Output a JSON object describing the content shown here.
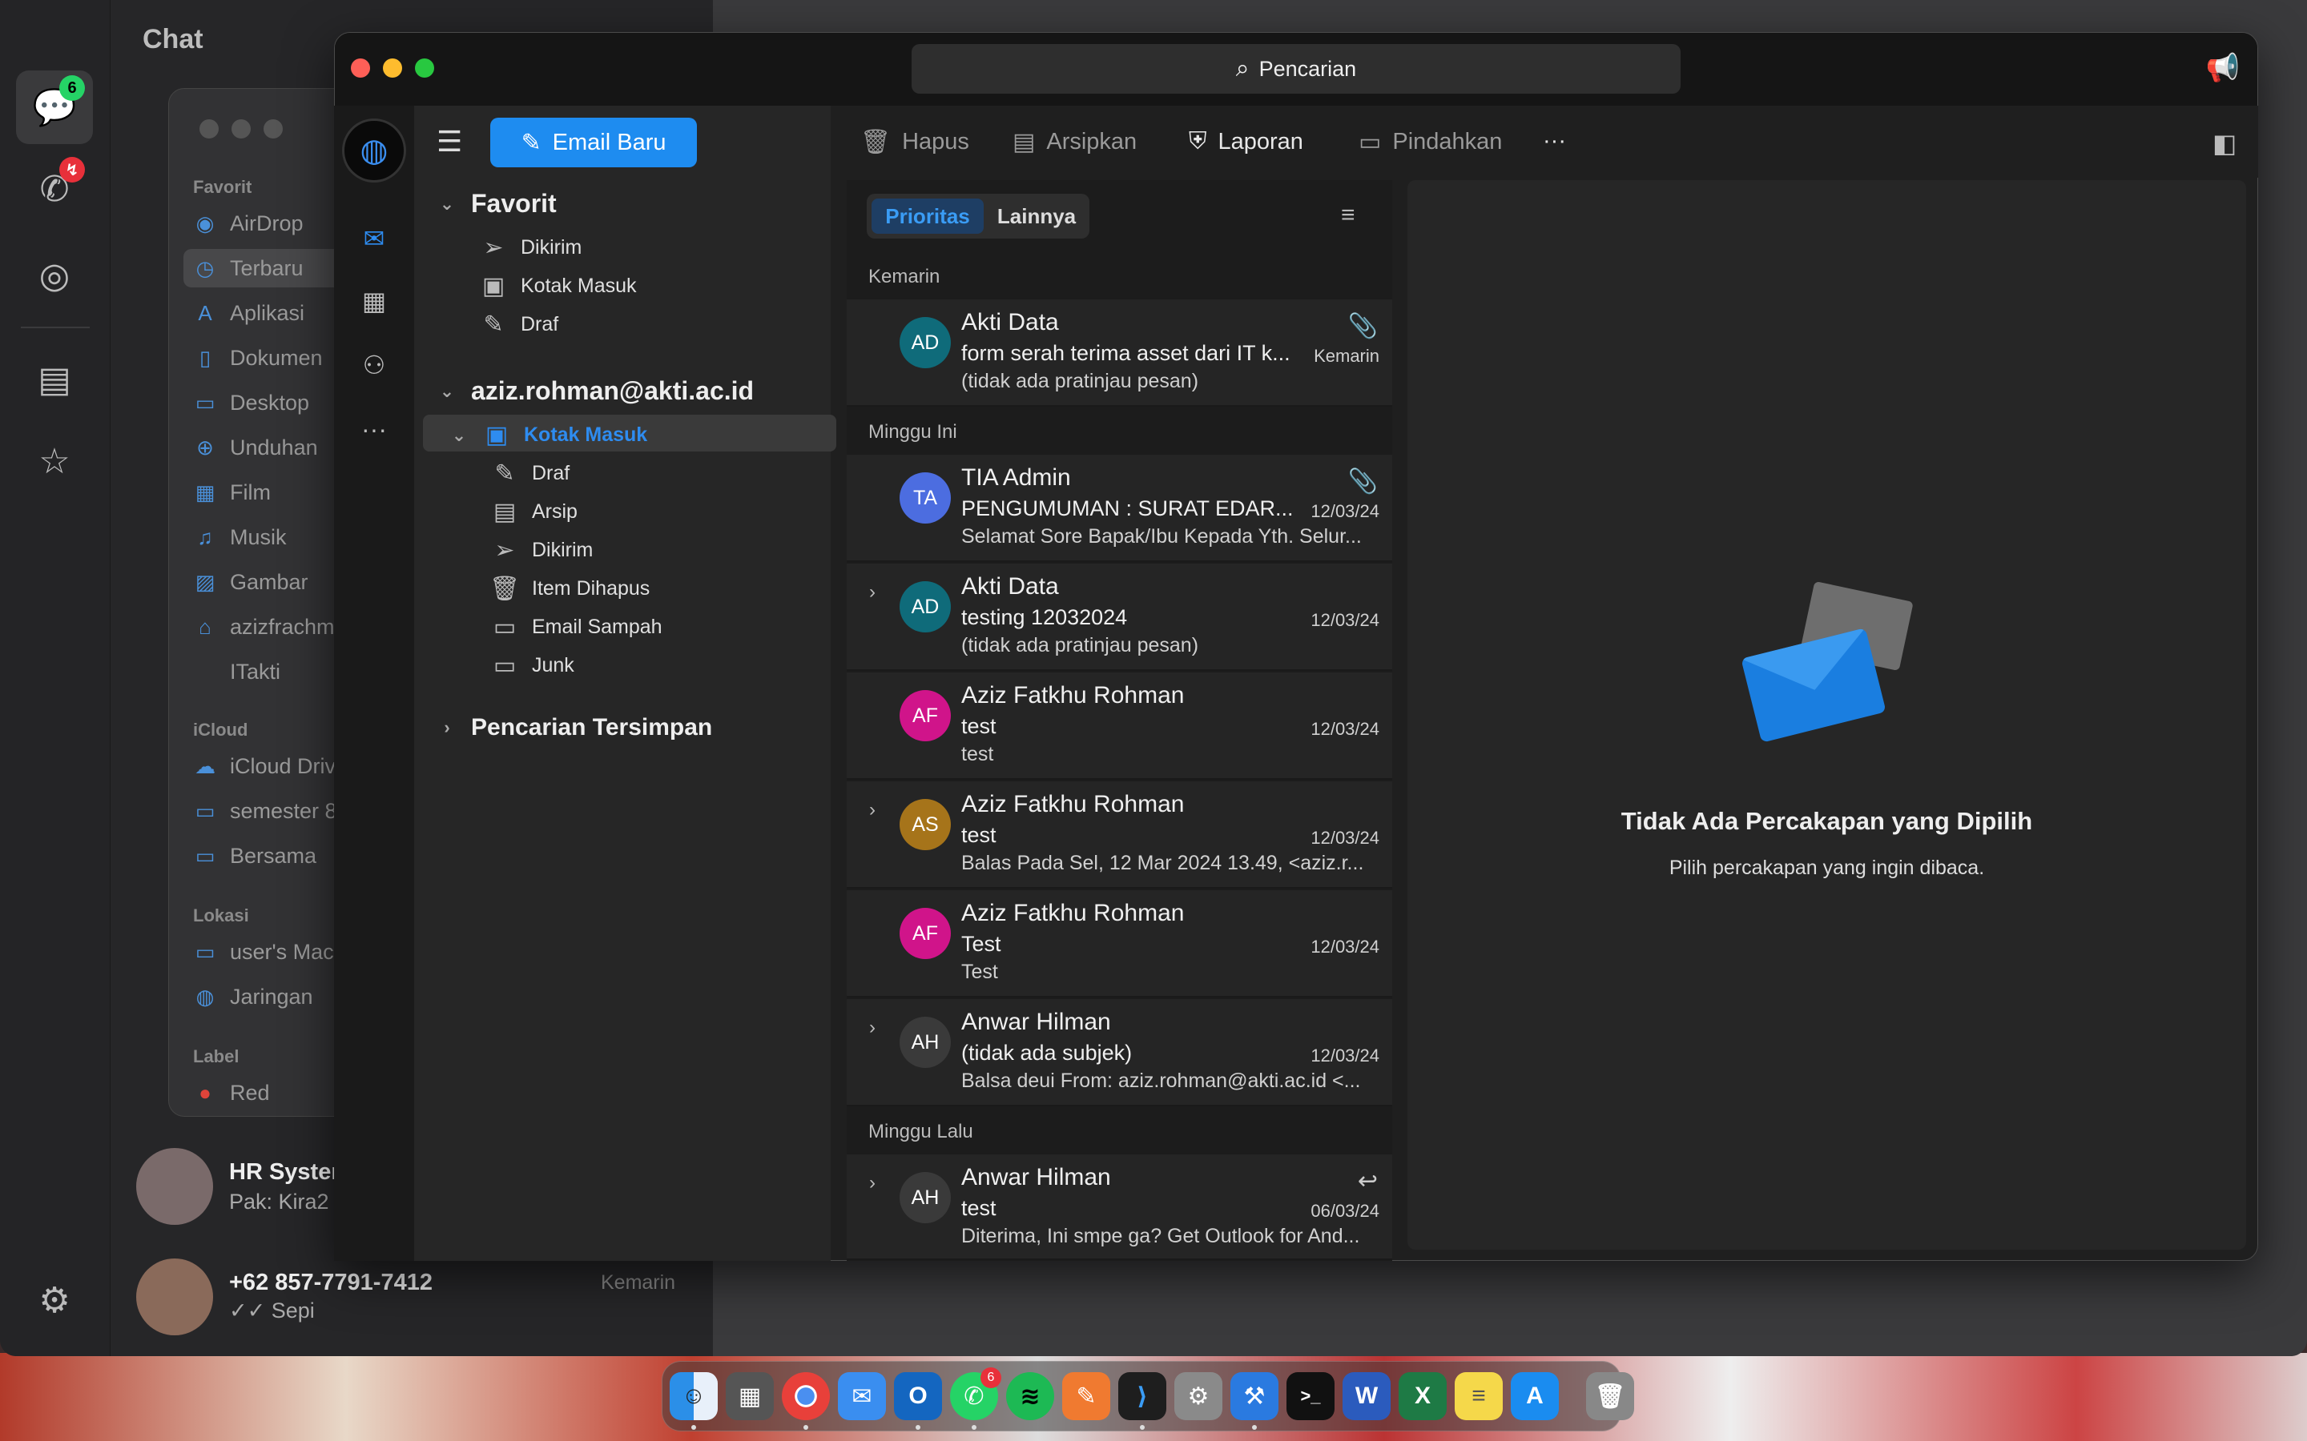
{
  "whatsapp": {
    "title": "Chat",
    "rail_badges": {
      "chats": "6"
    },
    "chats": [
      {
        "name": "HR Syster",
        "preview": "Pak: Kira2"
      },
      {
        "name": "+62 857-7791-7412",
        "preview": "✓✓ Sepi",
        "time": "Kemarin"
      }
    ]
  },
  "finder": {
    "sections": [
      {
        "title": "Favorit",
        "items": [
          "AirDrop",
          "Terbaru",
          "Aplikasi",
          "Dokumen",
          "Desktop",
          "Unduhan",
          "Film",
          "Musik",
          "Gambar",
          "azizfrachm",
          "ITakti"
        ]
      },
      {
        "title": "iCloud",
        "items": [
          "iCloud Driv",
          "semester 8",
          "Bersama"
        ]
      },
      {
        "title": "Lokasi",
        "items": [
          "user's Mac",
          "Jaringan"
        ]
      },
      {
        "title": "Label",
        "items": [
          "Red"
        ]
      }
    ]
  },
  "outlook": {
    "search_placeholder": "Pencarian",
    "new_mail": "Email Baru",
    "toolbar": {
      "delete": "Hapus",
      "archive": "Arsipkan",
      "report": "Laporan",
      "move": "Pindahkan",
      "more": "···"
    },
    "nav": {
      "favorites_title": "Favorit",
      "favorites": [
        "Dikirim",
        "Kotak Masuk",
        "Draf"
      ],
      "account": "aziz.rohman@akti.ac.id",
      "inbox": "Kotak Masuk",
      "folders": [
        "Draf",
        "Arsip",
        "Dikirim",
        "Item Dihapus",
        "Email Sampah",
        "Junk"
      ],
      "saved_searches": "Pencarian Tersimpan"
    },
    "tabs": {
      "focused": "Prioritas",
      "other": "Lainnya"
    },
    "headers": {
      "yesterday": "Kemarin",
      "this_week": "Minggu Ini",
      "last_week": "Minggu Lalu"
    },
    "messages": [
      {
        "initials": "AD",
        "color": "#0f6b7a",
        "sender": "Akti Data",
        "subject": "form serah terima asset dari IT k...",
        "preview": "(tidak ada pratinjau pesan)",
        "date": "Kemarin",
        "icon": "paperclip-icon"
      },
      {
        "initials": "TA",
        "color": "#4c6de0",
        "sender": "TIA Admin",
        "subject": "PENGUMUMAN : SURAT EDAR...",
        "preview": "Selamat Sore Bapak/Ibu Kepada Yth. Selur...",
        "date": "12/03/24",
        "icon": "paperclip-icon"
      },
      {
        "initials": "AD",
        "color": "#0f6b7a",
        "sender": "Akti Data",
        "subject": "testing 12032024",
        "preview": "(tidak ada pratinjau pesan)",
        "date": "12/03/24",
        "expand": true
      },
      {
        "initials": "AF",
        "color": "#d0148a",
        "sender": "Aziz Fatkhu Rohman",
        "subject": "test",
        "preview": "test",
        "date": "12/03/24"
      },
      {
        "initials": "AS",
        "color": "#a6741a",
        "sender": "Aziz Fatkhu Rohman",
        "subject": "test",
        "preview": "Balas Pada Sel, 12 Mar 2024 13.49, <aziz.r...",
        "date": "12/03/24",
        "expand": true
      },
      {
        "initials": "AF",
        "color": "#d0148a",
        "sender": "Aziz Fatkhu Rohman",
        "subject": "Test",
        "preview": "Test",
        "date": "12/03/24"
      },
      {
        "initials": "AH",
        "color": "#3a3a3a",
        "sender": "Anwar Hilman",
        "subject": "(tidak ada subjek)",
        "preview": "Balsa deui From: aziz.rohman@akti.ac.id <...",
        "date": "12/03/24",
        "expand": true
      },
      {
        "initials": "AH",
        "color": "#3a3a3a",
        "sender": "Anwar Hilman",
        "subject": "test",
        "preview": "Diterima, Ini smpe ga? Get Outlook for And...",
        "date": "06/03/24",
        "expand": true,
        "icon": "reply-icon"
      }
    ],
    "reading_pane": {
      "title": "Tidak Ada Percakapan yang Dipilih",
      "subtitle": "Pilih percakapan yang ingin dibaca."
    }
  },
  "dock": {
    "whatsapp_badge": "6"
  }
}
